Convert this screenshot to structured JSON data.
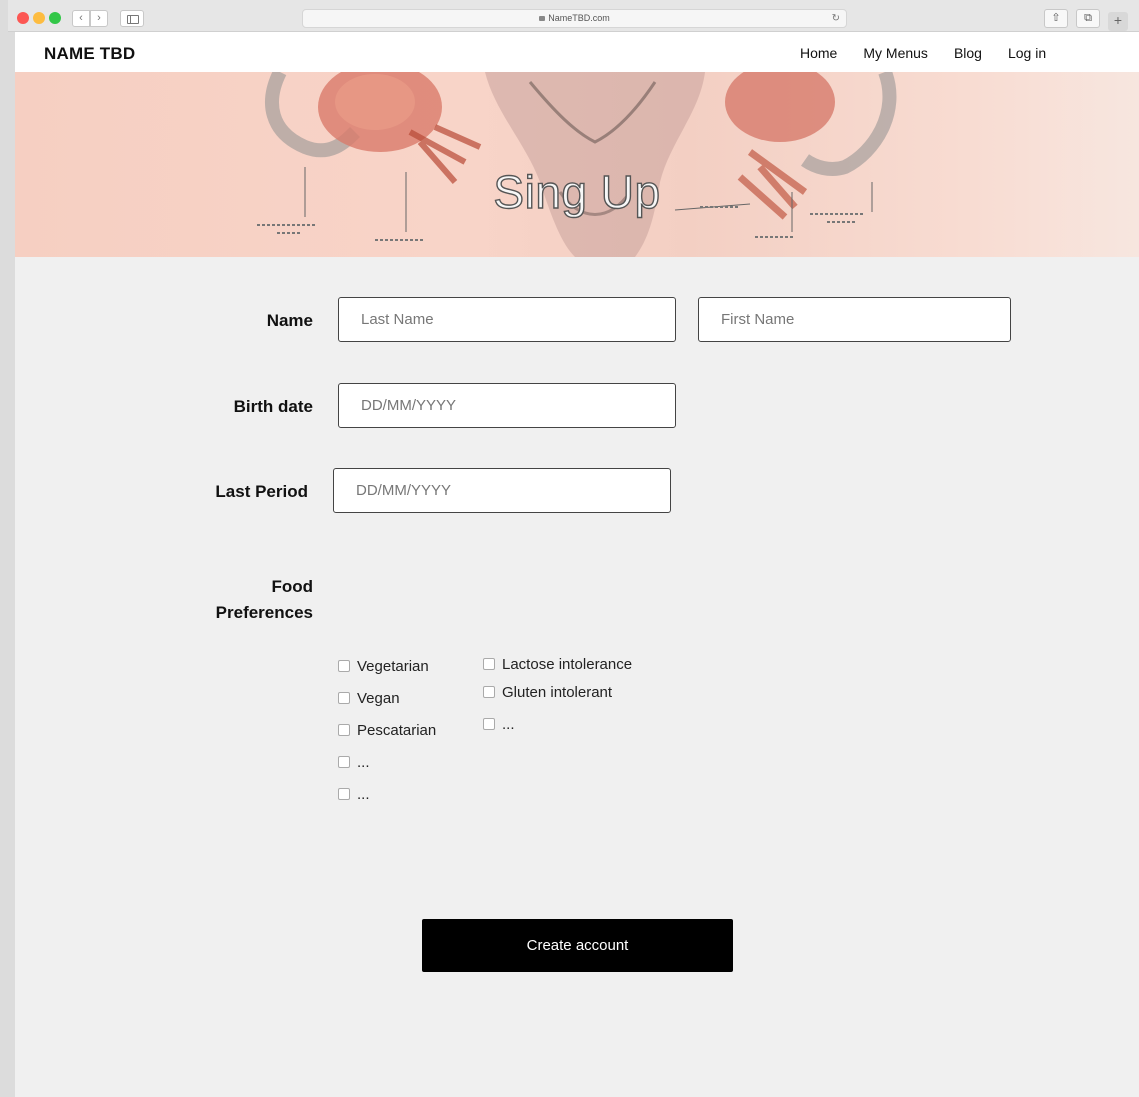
{
  "browser": {
    "url": "NameTBD.com",
    "back_glyph": "‹",
    "forward_glyph": "›",
    "reload_glyph": "↻",
    "share_glyph": "⇧",
    "tabs_glyph": "⧉",
    "newtab_glyph": "+"
  },
  "header": {
    "logo": "NAME TBD",
    "nav": [
      "Home",
      "My Menus",
      "Blog",
      "Log in"
    ]
  },
  "hero": {
    "title": "Sing Up",
    "illustration": "uterus anatomy drawing"
  },
  "form": {
    "name_label": "Name",
    "last_name_placeholder": "Last Name",
    "first_name_placeholder": "First Name",
    "birth_label": "Birth date",
    "birth_placeholder": "DD/MM/YYYY",
    "period_label": "Last Period",
    "period_placeholder": "DD/MM/YYYY",
    "food_label_line1": "Food",
    "food_label_line2": "Preferences",
    "food_col1": [
      "Vegetarian",
      "Vegan",
      "Pescatarian",
      "...",
      "..."
    ],
    "food_col2": [
      "Lactose intolerance",
      "Gluten intolerant",
      "..."
    ],
    "submit_label": "Create account"
  },
  "colors": {
    "page_bg": "#f0f0f0",
    "hero_pink": "#f6cfc2",
    "button_bg": "#000000"
  }
}
